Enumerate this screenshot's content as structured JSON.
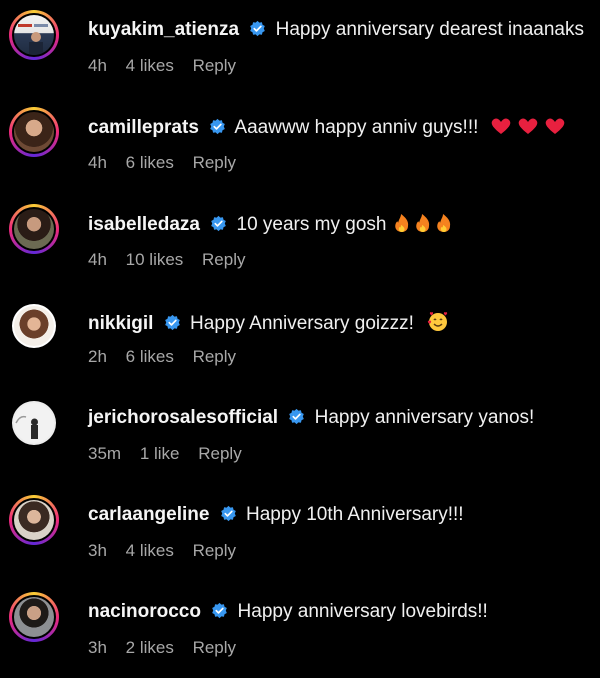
{
  "comments": [
    {
      "username": "kuyakim_atienza",
      "text": "Happy anniversary dearest inaanaks",
      "time": "4h",
      "likes": "4 likes",
      "reply": "Reply",
      "emoji": ""
    },
    {
      "username": "camilleprats",
      "text": "Aaawww happy anniv guys!!!",
      "time": "4h",
      "likes": "6 likes",
      "reply": "Reply",
      "emoji": "hearts"
    },
    {
      "username": "isabelledaza",
      "text": "10 years my gosh",
      "time": "4h",
      "likes": "10 likes",
      "reply": "Reply",
      "emoji": "fires"
    },
    {
      "username": "nikkigil",
      "text": "Happy Anniversary goizzz!",
      "time": "2h",
      "likes": "6 likes",
      "reply": "Reply",
      "emoji": "hearts-face"
    },
    {
      "username": "jerichorosalesofficial",
      "text": "Happy anniversary yanos!",
      "time": "35m",
      "likes": "1 like",
      "reply": "Reply",
      "emoji": ""
    },
    {
      "username": "carlaangeline",
      "text": "Happy 10th Anniversary!!!",
      "time": "3h",
      "likes": "4 likes",
      "reply": "Reply",
      "emoji": ""
    },
    {
      "username": "nacinorocco",
      "text": "Happy anniversary lovebirds!!",
      "time": "3h",
      "likes": "2 likes",
      "reply": "Reply",
      "emoji": ""
    }
  ],
  "icons": {
    "verified": "verified-badge-icon",
    "heart": "red-heart-icon",
    "fire": "fire-icon",
    "hearts_face": "smiling-face-with-hearts-icon"
  },
  "colors": {
    "background": "#000000",
    "verified": "#3897f0",
    "secondary_text": "#a8a8a8",
    "heart": "#e8203f",
    "fire": "#f5821f"
  }
}
